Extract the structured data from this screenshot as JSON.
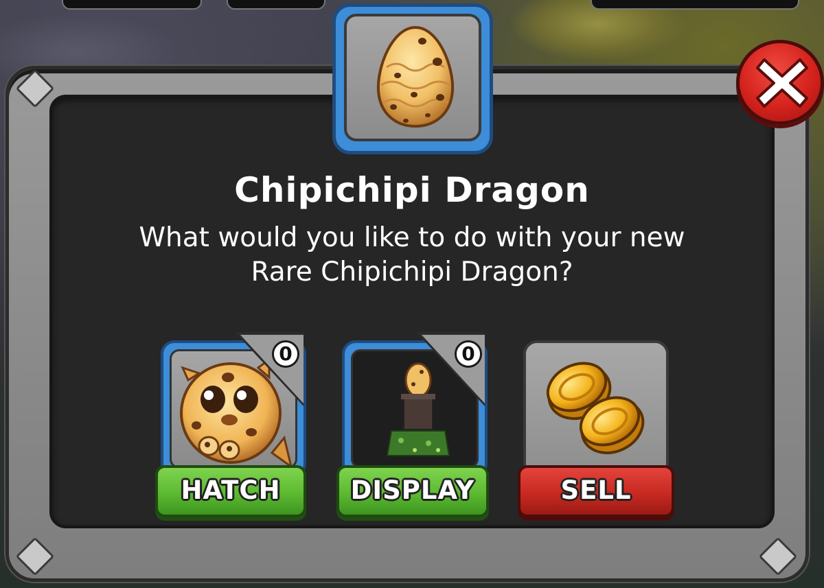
{
  "dialog": {
    "title": "Chipichipi Dragon",
    "message_line1": "What would you like to do with your new",
    "message_line2": "Rare Chipichipi Dragon?",
    "close_icon": "close-icon"
  },
  "options": [
    {
      "label": "HATCH",
      "count": "0",
      "icon": "chipichipi-dragon-icon",
      "style": "green"
    },
    {
      "label": "DISPLAY",
      "count": "0",
      "icon": "egg-pedestal-icon",
      "style": "green"
    },
    {
      "label": "SELL",
      "icon": "gold-coins-icon",
      "style": "red"
    }
  ],
  "colors": {
    "panel_border": "#2c2c2c",
    "panel_fill": "#262626",
    "slot_blue": "#3d8dd8",
    "button_green": "#5cba31",
    "button_red": "#c72a22",
    "close_red": "#d4221c"
  }
}
